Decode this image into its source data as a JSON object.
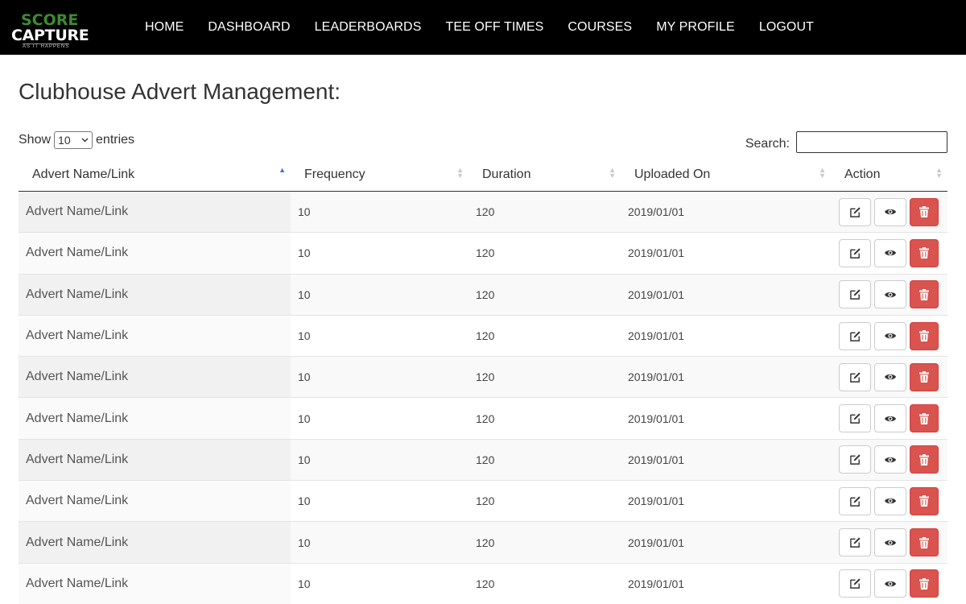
{
  "brand": {
    "logo_top": "SCORE",
    "logo_bottom": "CAPTURE",
    "logo_tagline": "AS IT HAPPENS"
  },
  "nav": {
    "items": [
      "HOME",
      "DASHBOARD",
      "LEADERBOARDS",
      "TEE OFF TIMES",
      "COURSES",
      "MY PROFILE",
      "LOGOUT"
    ]
  },
  "page": {
    "title": "Clubhouse Advert Management:"
  },
  "controls": {
    "show_label": "Show",
    "entries_value": "10",
    "entries_label": "entries",
    "search_label": "Search:",
    "search_value": ""
  },
  "table": {
    "columns": [
      "Advert Name/Link",
      "Frequency",
      "Duration",
      "Uploaded On",
      "Action"
    ],
    "sorted_column": "Advert Name/Link",
    "rows": [
      [
        "Advert Name/Link",
        "10",
        "120",
        "2019/01/01"
      ],
      [
        "Advert Name/Link",
        "10",
        "120",
        "2019/01/01"
      ],
      [
        "Advert Name/Link",
        "10",
        "120",
        "2019/01/01"
      ],
      [
        "Advert Name/Link",
        "10",
        "120",
        "2019/01/01"
      ],
      [
        "Advert Name/Link",
        "10",
        "120",
        "2019/01/01"
      ],
      [
        "Advert Name/Link",
        "10",
        "120",
        "2019/01/01"
      ],
      [
        "Advert Name/Link",
        "10",
        "120",
        "2019/01/01"
      ],
      [
        "Advert Name/Link",
        "10",
        "120",
        "2019/01/01"
      ],
      [
        "Advert Name/Link",
        "10",
        "120",
        "2019/01/01"
      ],
      [
        "Advert Name/Link",
        "10",
        "120",
        "2019/01/01"
      ]
    ],
    "action_icons": [
      "edit-icon",
      "eye-icon",
      "trash-icon"
    ]
  },
  "colors": {
    "navbar": "#000000",
    "brand_green": "#3d8b2f",
    "delete_button": "#d9534f",
    "sort_active": "#4a6bd6"
  }
}
